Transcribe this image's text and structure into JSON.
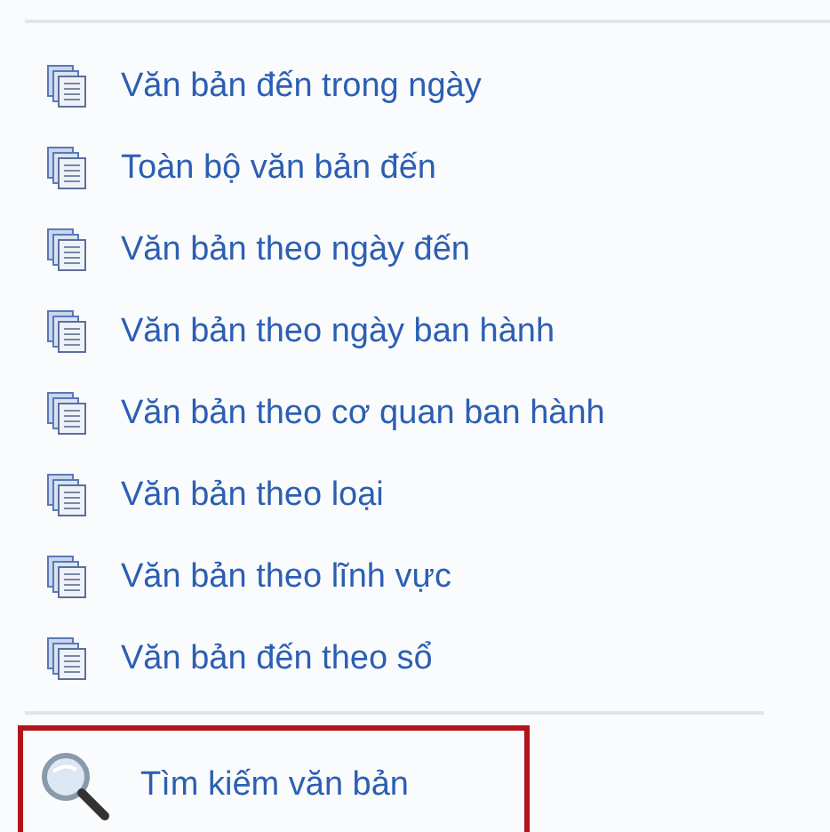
{
  "menu_items": [
    {
      "label": "Văn bản đến trong ngày"
    },
    {
      "label": "Toàn bộ văn bản đến"
    },
    {
      "label": "Văn bản theo ngày đến"
    },
    {
      "label": "Văn bản theo ngày ban hành"
    },
    {
      "label": "Văn bản theo cơ quan ban hành"
    },
    {
      "label": "Văn bản theo loại"
    },
    {
      "label": "Văn bản theo lĩnh vực"
    },
    {
      "label": "Văn bản đến theo sổ"
    }
  ],
  "search_link": {
    "label": "Tìm kiếm văn bản",
    "highlighted": true
  }
}
